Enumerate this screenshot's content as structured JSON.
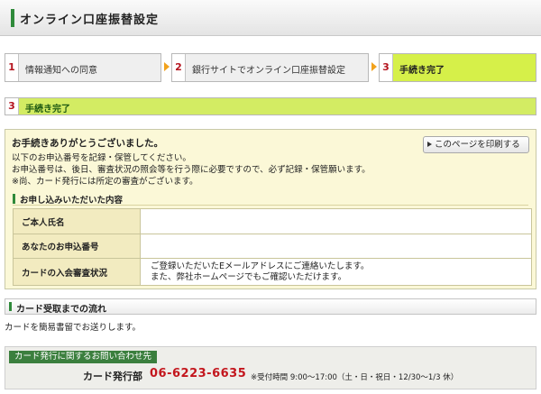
{
  "page": {
    "title": "オンライン口座振替設定"
  },
  "steps": [
    {
      "num": "1",
      "label": "情報通知への同意"
    },
    {
      "num": "2",
      "label": "銀行サイトでオンライン口座振替設定"
    },
    {
      "num": "3",
      "label": "手続き完了"
    }
  ],
  "section": {
    "num": "3",
    "label": "手続き完了"
  },
  "thanks": {
    "heading": "お手続きありがとうございました。",
    "lines": [
      "以下のお申込番号を記録・保管してください。",
      "お申込番号は、後日、審査状況の照会等を行う際に必要ですので、必ず記録・保管願います。",
      "※尚、カード発行には所定の審査がございます。"
    ],
    "print_button": "このページを印刷する"
  },
  "application": {
    "heading": "お申し込みいただいた内容",
    "rows": [
      {
        "label": "ご本人氏名",
        "value": ""
      },
      {
        "label": "あなたのお申込番号",
        "value": ""
      },
      {
        "label": "カードの入会審査状況",
        "value_lines": [
          "ご登録いただいたEメールアドレスにご連絡いたします。",
          "また、弊社ホームページでもご確認いただけます。"
        ]
      }
    ]
  },
  "delivery": {
    "heading": "カード受取までの流れ",
    "text": "カードを簡易書留でお送りします。"
  },
  "contact": {
    "tag": "カード発行に関するお問い合わせ先",
    "department": "カード発行部",
    "phone": "06-6223-6635",
    "hours": "※受付時間 9:00～17:00（土・日・祝日・12/30～1/3 休）"
  },
  "colors": {
    "accent_green": "#2f8a3a",
    "active_step": "#d6f049",
    "step_number_red": "#b4141e",
    "phone_red": "#c3161d"
  }
}
